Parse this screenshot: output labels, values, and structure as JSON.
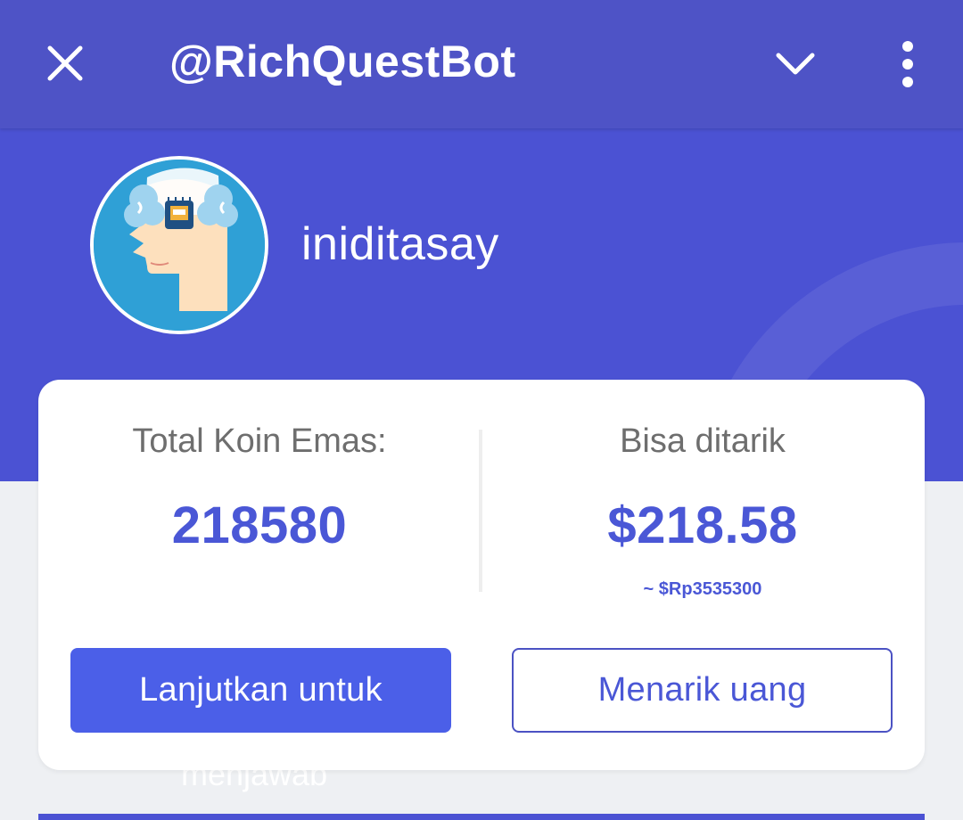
{
  "header": {
    "title": "@RichQuestBot",
    "close_icon": "close-icon",
    "chevron_icon": "chevron-down-icon",
    "more_icon": "more-vertical-icon",
    "background_color": "#4e53c6"
  },
  "profile": {
    "username": "iniditasay",
    "avatar_icon": "ai-brain-head-avatar"
  },
  "balance_card": {
    "left_label": "Total Koin Emas:",
    "left_value": "218580",
    "right_label": "Bisa ditarik",
    "right_value": "$218.58",
    "right_sub_value": "~ $Rp3535300",
    "accent_color": "#4a57d6"
  },
  "actions": {
    "continue_label": "Lanjutkan untuk",
    "withdraw_label": "Menarik uang",
    "primary_color": "#4b5fe8"
  },
  "overflow_text": "menjawab"
}
